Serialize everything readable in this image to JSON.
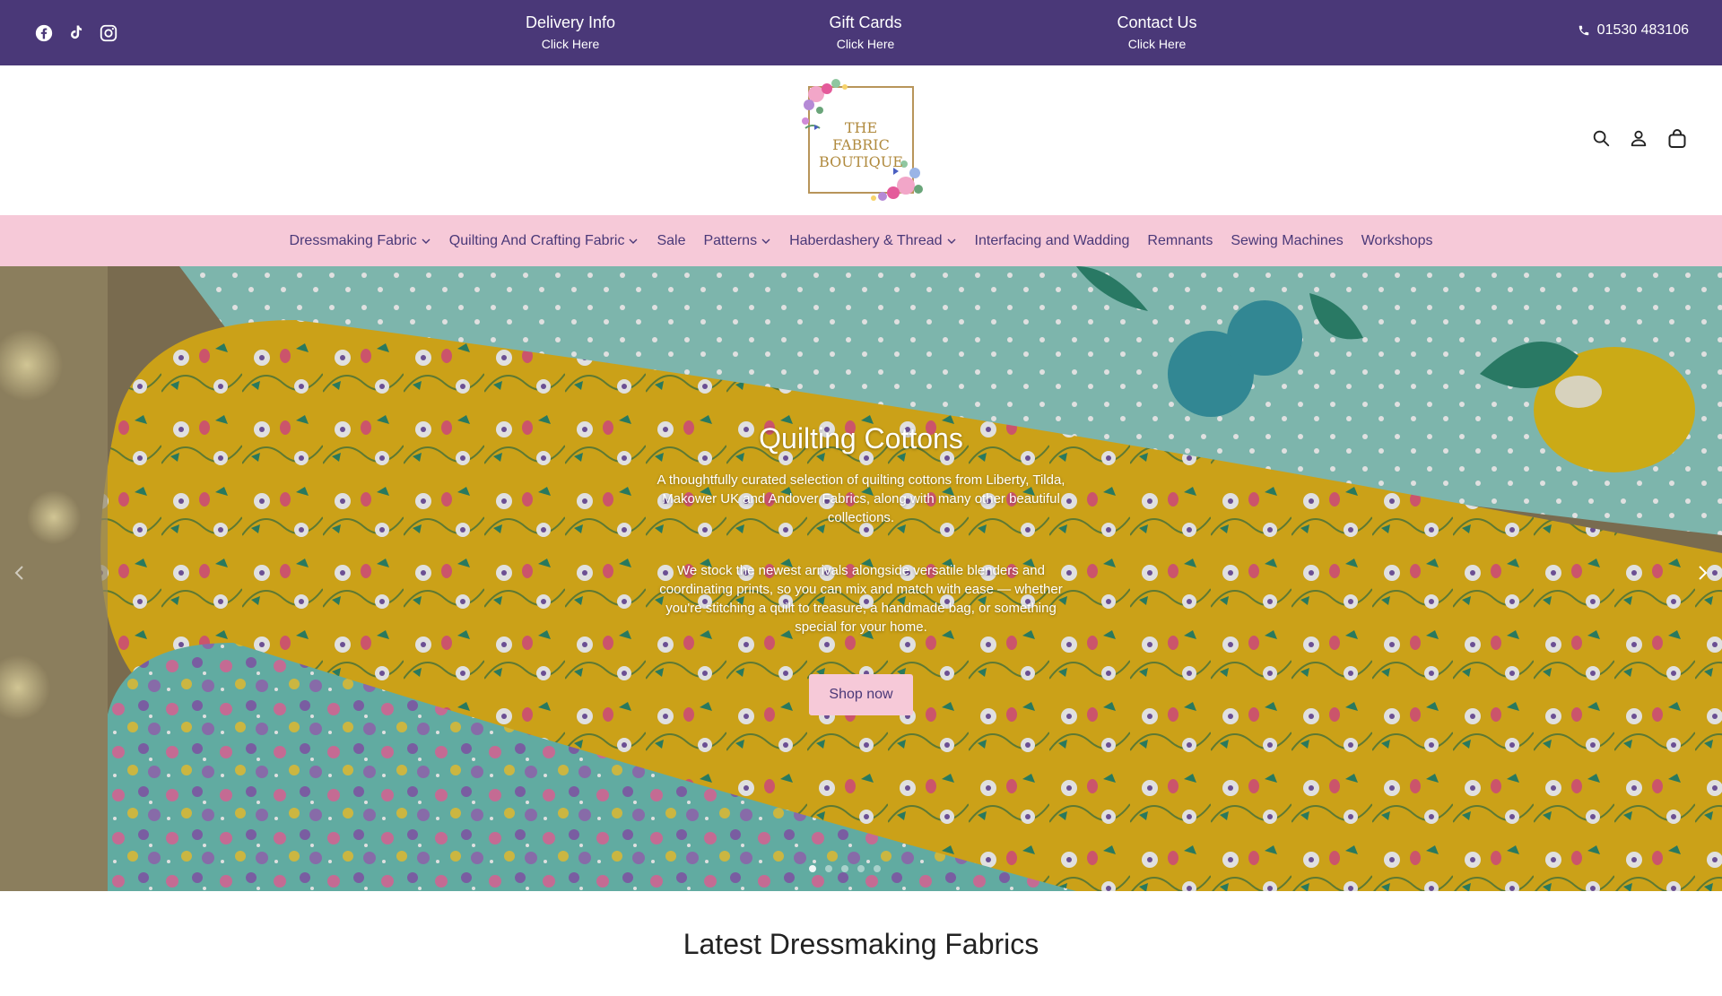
{
  "announcement": {
    "social_icons": [
      "facebook-icon",
      "tiktok-icon",
      "instagram-icon"
    ],
    "links": [
      {
        "title": "Delivery Info",
        "subtitle": "Click Here"
      },
      {
        "title": "Gift Cards",
        "subtitle": "Click Here"
      },
      {
        "title": "Contact Us",
        "subtitle": "Click Here"
      }
    ],
    "phone": "01530 483106"
  },
  "header": {
    "logo_text": [
      "THE",
      "FABRIC",
      "BOUTIQUE"
    ],
    "icons": [
      "search-icon",
      "account-icon",
      "cart-icon"
    ]
  },
  "nav": {
    "items": [
      {
        "label": "Dressmaking Fabric",
        "dropdown": true
      },
      {
        "label": "Quilting And Crafting Fabric",
        "dropdown": true
      },
      {
        "label": "Sale",
        "dropdown": false
      },
      {
        "label": "Patterns",
        "dropdown": true
      },
      {
        "label": "Haberdashery & Thread",
        "dropdown": true
      },
      {
        "label": "Interfacing and Wadding",
        "dropdown": false
      },
      {
        "label": "Remnants",
        "dropdown": false
      },
      {
        "label": "Sewing Machines",
        "dropdown": false
      },
      {
        "label": "Workshops",
        "dropdown": false
      }
    ]
  },
  "hero": {
    "title": "Quilting Cottons",
    "paragraph1": "A thoughtfully curated selection of quilting cottons from Liberty, Tilda, Makower UK and Andover Fabrics, along with many other beautiful collections.",
    "paragraph2": "We stock the newest arrivals alongside versatile blenders and coordinating prints, so you can mix and match with ease — whether you're stitching a quilt to treasure, a handmade bag, or something special for your home.",
    "button_label": "Shop now",
    "slide_count": 5,
    "active_slide": 1
  },
  "section": {
    "title": "Latest Dressmaking Fabrics"
  },
  "colors": {
    "topbar": "#4a3878",
    "nav_background": "#f6c9d8",
    "accent_text": "#4a3878"
  }
}
